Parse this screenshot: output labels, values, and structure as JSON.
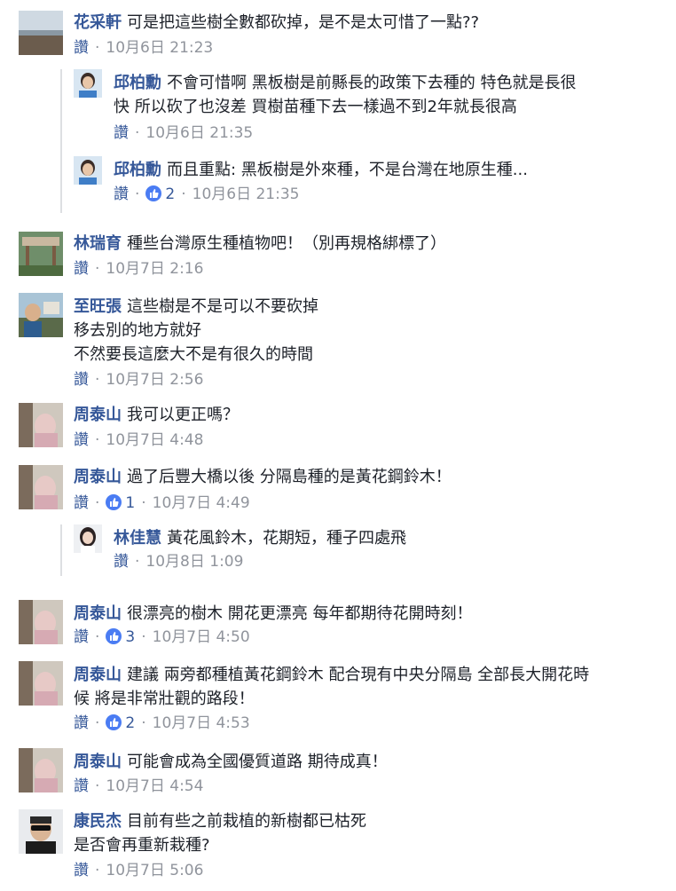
{
  "like_label": "讚",
  "dot": "·",
  "colors": {
    "name": "#365899",
    "meta": "#90949c",
    "reaction_blue": "#4a7cf3",
    "thread_bar": "#dddfe2"
  },
  "comments": [
    {
      "name": "花采軒",
      "lines": [
        "可是把這些樹全數都砍掉，是不是太可惜了一點??"
      ],
      "time": "10月6日 21:23"
    },
    {
      "name": "邱柏勳",
      "lines": [
        "不會可惜啊 黑板樹是前縣長的政策下去種的 特色就是長很",
        "快 所以砍了也沒差 買樹苗種下去一樣過不到2年就長很高"
      ],
      "time": "10月6日 21:35"
    },
    {
      "name": "邱柏勳",
      "lines": [
        "而且重點: 黑板樹是外來種，不是台灣在地原生種..."
      ],
      "reactions": "2",
      "time": "10月6日 21:35"
    },
    {
      "name": "林瑞育",
      "lines": [
        "種些台灣原生種植物吧！（別再規格綁標了）"
      ],
      "time": "10月7日 2:16"
    },
    {
      "name": "至旺張",
      "lines": [
        "這些樹是不是可以不要砍掉",
        "移去別的地方就好",
        "不然要長這麼大不是有很久的時間"
      ],
      "time": "10月7日 2:56"
    },
    {
      "name": "周泰山",
      "lines": [
        "我可以更正嗎？"
      ],
      "time": "10月7日 4:48"
    },
    {
      "name": "周泰山",
      "lines": [
        "過了后豐大橋以後 分隔島種的是黃花鋼鈴木！"
      ],
      "reactions": "1",
      "time": "10月7日 4:49"
    },
    {
      "name": "林佳慧",
      "lines": [
        "黃花風鈴木，花期短，種子四處飛"
      ],
      "time": "10月8日 1:09"
    },
    {
      "name": "周泰山",
      "lines": [
        "很漂亮的樹木 開花更漂亮 每年都期待花開時刻！"
      ],
      "reactions": "3",
      "time": "10月7日 4:50"
    },
    {
      "name": "周泰山",
      "lines": [
        "建議 兩旁都種植黃花鋼鈴木 配合現有中央分隔島 全部長大開花時",
        "候 將是非常壯觀的路段！"
      ],
      "reactions": "2",
      "time": "10月7日 4:53"
    },
    {
      "name": "周泰山",
      "lines": [
        "可能會成為全國優質道路 期待成真！"
      ],
      "time": "10月7日 4:54"
    },
    {
      "name": "康民杰",
      "lines": [
        "目前有些之前栽植的新樹都已枯死",
        "是否會再重新栽種?"
      ],
      "time": "10月7日 5:06"
    }
  ]
}
